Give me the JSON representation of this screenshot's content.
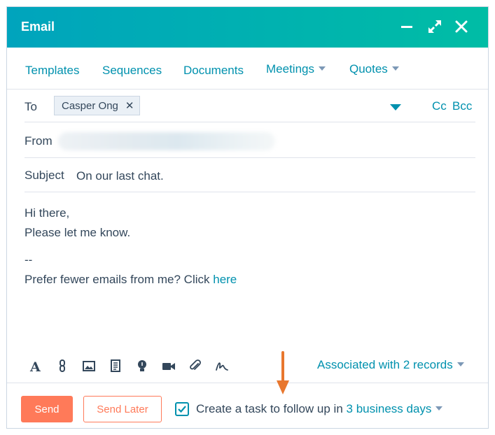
{
  "window": {
    "title": "Email",
    "controls": [
      "minimize-icon",
      "expand-icon",
      "close-icon"
    ],
    "header_gradient": [
      "#00a4bd",
      "#00bda5"
    ]
  },
  "toolbar": {
    "templates": "Templates",
    "sequences": "Sequences",
    "documents": "Documents",
    "meetings": "Meetings",
    "quotes": "Quotes"
  },
  "recipients": {
    "to_label": "To",
    "to_chip": "Casper Ong",
    "cc": "Cc",
    "bcc": "Bcc"
  },
  "from": {
    "label": "From"
  },
  "subject": {
    "label": "Subject",
    "value": "On our last chat."
  },
  "message": {
    "line1": "Hi there,",
    "line2": "Please let me know.",
    "separator": "--",
    "unsubscribe_text": "Prefer fewer emails from me? Click ",
    "unsubscribe_link": "here"
  },
  "format_tools": [
    "text-format-icon",
    "link-icon",
    "image-icon",
    "snippet-icon",
    "knowledge-icon",
    "video-icon",
    "attachment-icon",
    "signature-icon"
  ],
  "associations": {
    "label": "Associated with 2 records"
  },
  "footer": {
    "send": "Send",
    "send_later": "Send Later",
    "task_checked": true,
    "task_text": "Create a task to follow up in ",
    "task_delay": "3 business days"
  },
  "colors": {
    "accent": "#0091ae",
    "primary_button": "#ff7a59",
    "annotation_arrow": "#e8772e"
  }
}
